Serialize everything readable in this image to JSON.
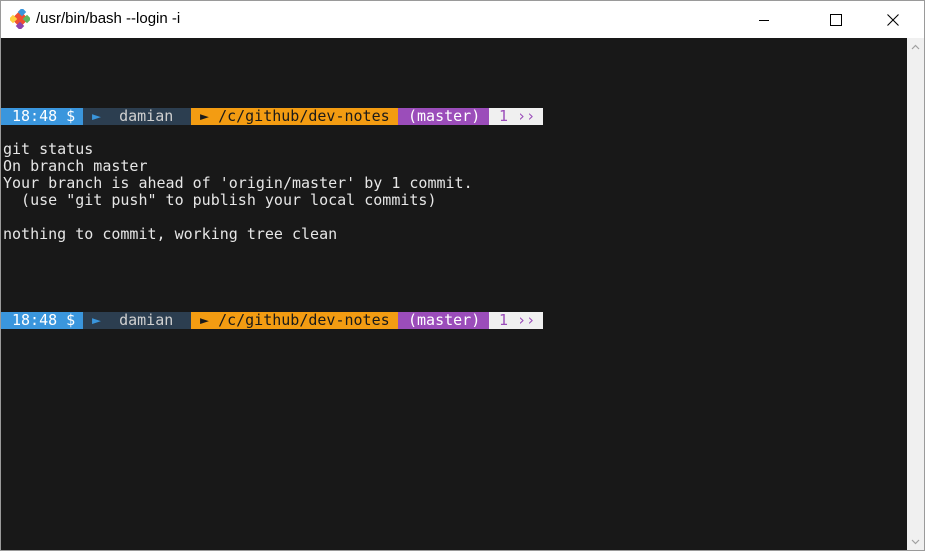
{
  "window": {
    "title": "/usr/bin/bash --login -i",
    "icon": "git-logo-icon",
    "controls": {
      "minimize": "minimize-icon",
      "maximize": "maximize-icon",
      "close": "close-icon"
    }
  },
  "colors": {
    "terminal_bg": "#181818",
    "time_segment": "#3a96dd",
    "user_segment": "#2c3e50",
    "path_segment": "#f39c12",
    "branch_segment": "#9b4dba",
    "count_segment": "#f0f0f0"
  },
  "prompts": [
    {
      "time": "18:48 $",
      "arrow": "►",
      "user": "damian",
      "path_arrow": "►",
      "path": "/c/github/dev-notes",
      "branch": "(master)",
      "count": "1 ››"
    },
    {
      "time": "18:48 $",
      "arrow": "►",
      "user": "damian",
      "path_arrow": "►",
      "path": "/c/github/dev-notes",
      "branch": "(master)",
      "count": "1 ››"
    }
  ],
  "output": {
    "command": "git status",
    "line1": "On branch master",
    "line2": "Your branch is ahead of 'origin/master' by 1 commit.",
    "line3": "  (use \"git push\" to publish your local commits)",
    "line4": "nothing to commit, working tree clean"
  }
}
